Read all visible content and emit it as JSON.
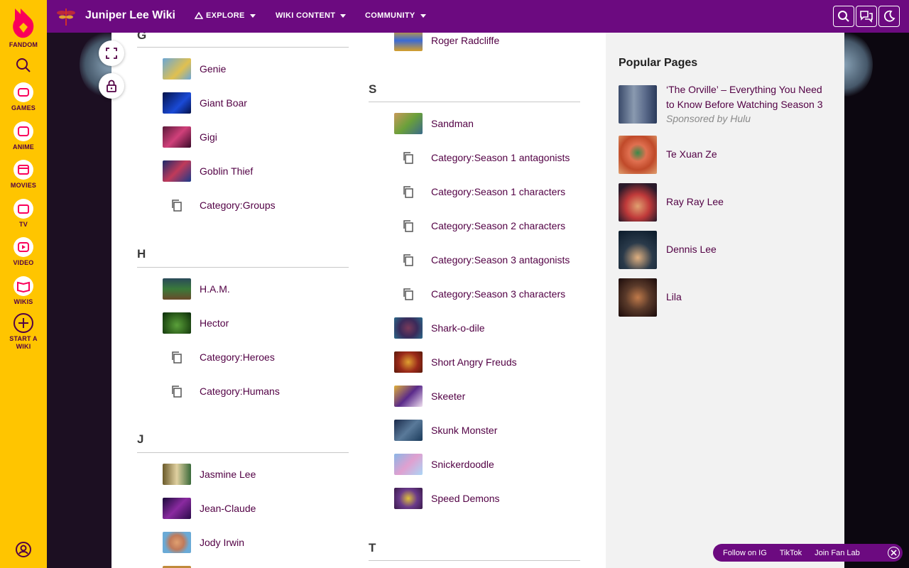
{
  "global_nav": {
    "brand": "FANDOM",
    "items": [
      {
        "label": "GAMES",
        "icon": "controller-icon"
      },
      {
        "label": "ANIME",
        "icon": "anime-icon"
      },
      {
        "label": "MOVIES",
        "icon": "clapper-icon"
      },
      {
        "label": "TV",
        "icon": "tv-icon"
      },
      {
        "label": "VIDEO",
        "icon": "play-icon"
      },
      {
        "label": "WIKIS",
        "icon": "book-icon"
      }
    ],
    "start_wiki": "START A WIKI"
  },
  "topbar": {
    "wiki_title": "Juniper Lee Wiki",
    "nav": [
      "EXPLORE",
      "WIKI CONTENT",
      "COMMUNITY"
    ]
  },
  "columns": {
    "left": {
      "sections": [
        {
          "letter": "G",
          "items": [
            {
              "label": "Genie",
              "type": "page",
              "thumb": "#6aa6d6"
            },
            {
              "label": "Giant Boar",
              "type": "page",
              "thumb": "#0a2a8a"
            },
            {
              "label": "Gigi",
              "type": "page",
              "thumb": "#a02a5a"
            },
            {
              "label": "Goblin Thief",
              "type": "page",
              "thumb": "#1a3a8a"
            },
            {
              "label": "Category:Groups",
              "type": "category"
            }
          ]
        },
        {
          "letter": "H",
          "items": [
            {
              "label": "H.A.M.",
              "type": "page",
              "thumb": "#3a6a3a"
            },
            {
              "label": "Hector",
              "type": "page",
              "thumb": "#3f8a2a"
            },
            {
              "label": "Category:Heroes",
              "type": "category"
            },
            {
              "label": "Category:Humans",
              "type": "category"
            }
          ]
        },
        {
          "letter": "J",
          "items": [
            {
              "label": "Jasmine Lee",
              "type": "page",
              "thumb": "#8a9a5a"
            },
            {
              "label": "Jean-Claude",
              "type": "page",
              "thumb": "#4a1a6a"
            },
            {
              "label": "Jody Irwin",
              "type": "page",
              "thumb": "#6aaad6"
            }
          ]
        }
      ]
    },
    "right": {
      "top_item": {
        "label": "Roger Radcliffe",
        "thumb": "#d6a02a"
      },
      "sections": [
        {
          "letter": "S",
          "items": [
            {
              "label": "Sandman",
              "type": "page",
              "thumb": "#c89a5a"
            },
            {
              "label": "Category:Season 1 antagonists",
              "type": "category"
            },
            {
              "label": "Category:Season 1 characters",
              "type": "category"
            },
            {
              "label": "Category:Season 2 characters",
              "type": "category"
            },
            {
              "label": "Category:Season 3 antagonists",
              "type": "category"
            },
            {
              "label": "Category:Season 3 characters",
              "type": "category"
            },
            {
              "label": "Shark-o-dile",
              "type": "page",
              "thumb": "#4a3a6a"
            },
            {
              "label": "Short Angry Freuds",
              "type": "page",
              "thumb": "#9a2a1a"
            },
            {
              "label": "Skeeter",
              "type": "page",
              "thumb": "#e0b03a"
            },
            {
              "label": "Skunk Monster",
              "type": "page",
              "thumb": "#2a4a6a"
            },
            {
              "label": "Snickerdoodle",
              "type": "page",
              "thumb": "#8ab6e6"
            },
            {
              "label": "Speed Demons",
              "type": "page",
              "thumb": "#6a3a8a"
            }
          ]
        },
        {
          "letter": "T",
          "items": []
        }
      ]
    }
  },
  "rail": {
    "title": "Popular Pages",
    "items": [
      {
        "label": "‘The Orville’ – Everything You Need to Know Before Watching Season 3",
        "sponsor": "Sponsored by Hulu",
        "thumb": "#5a6a8a"
      },
      {
        "label": "Te Xuan Ze",
        "thumb": "#e07050"
      },
      {
        "label": "Ray Ray Lee",
        "thumb": "#c03a3a"
      },
      {
        "label": "Dennis Lee",
        "thumb": "#2a3a4a"
      },
      {
        "label": "Lila",
        "thumb": "#5a3a2a"
      }
    ]
  },
  "fan_bar": {
    "links": [
      "Follow on IG",
      "TikTok",
      "Join Fan Lab"
    ]
  },
  "colors": {
    "brand_yellow": "#ffc500",
    "community_purple": "#6c0a80",
    "link": "#520044"
  }
}
